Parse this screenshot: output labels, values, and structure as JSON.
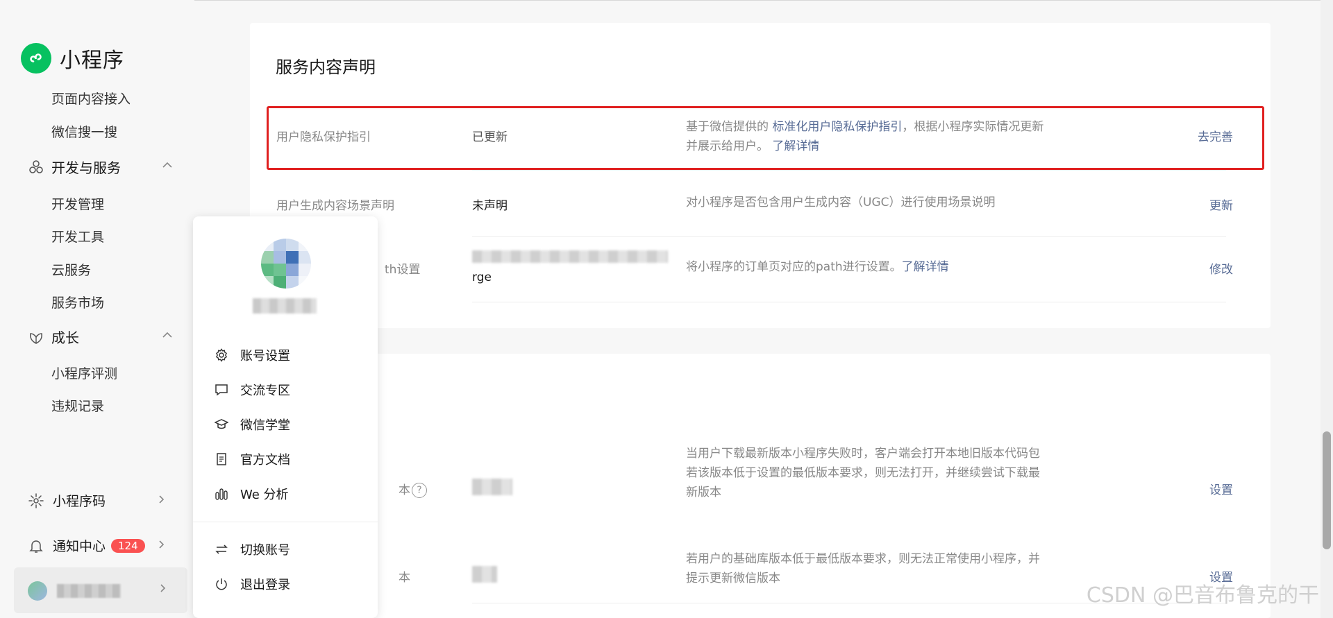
{
  "app": {
    "title": "小程序"
  },
  "sidebar": {
    "top_items": [
      "页面内容接入",
      "微信搜一搜"
    ],
    "groups": [
      {
        "label": "开发与服务",
        "items": [
          "开发管理",
          "开发工具",
          "云服务",
          "服务市场"
        ]
      },
      {
        "label": "成长",
        "items": [
          "小程序评测",
          "违规记录"
        ]
      }
    ],
    "bottom": {
      "qrcode_label": "小程序码",
      "notify_label": "通知中心",
      "notify_count": "124"
    }
  },
  "popup": {
    "items": [
      "账号设置",
      "交流专区",
      "微信学堂",
      "官方文档",
      "We 分析"
    ],
    "switch_label": "切换账号",
    "logout_label": "退出登录"
  },
  "card1": {
    "title": "服务内容声明",
    "rows": [
      {
        "name": "用户隐私保护指引",
        "status": "已更新",
        "desc_prefix": "基于微信提供的 ",
        "desc_link": "标准化用户隐私保护指引",
        "desc_suffix": "，根据小程序实际情况更新并展示给用户。 ",
        "desc_link2": "了解详情",
        "action": "去完善"
      },
      {
        "name": "用户生成内容场景声明",
        "status": "未声明",
        "desc": "对小程序是否包含用户生成内容（UGC）进行使用场景说明",
        "action": "更新"
      },
      {
        "name_visible": "th设置",
        "status_tail": "rge",
        "desc": "将小程序的订单页对应的path进行设置。",
        "desc_link": "了解详情",
        "action": "修改"
      }
    ]
  },
  "card2": {
    "rows": [
      {
        "name_visible": "本",
        "help": "?",
        "desc_line1": "当用户下载最新版本小程序失败时，客户端会打开本地旧版本代码包",
        "desc_line2": "若该版本低于设置的最低版本要求，则无法打开，并继续尝试下载最新版本",
        "action": "设置"
      },
      {
        "name_visible": "本",
        "desc": "若用户的基础库版本低于最低版本要求，则无法正常使用小程序，并提示更新微信版本",
        "action": "设置"
      }
    ]
  },
  "watermark": "CSDN @巴音布鲁克的干",
  "colors": {
    "brand": "#07c160",
    "link": "#576b95",
    "badge": "#fa5151",
    "highlight": "#e02020"
  }
}
